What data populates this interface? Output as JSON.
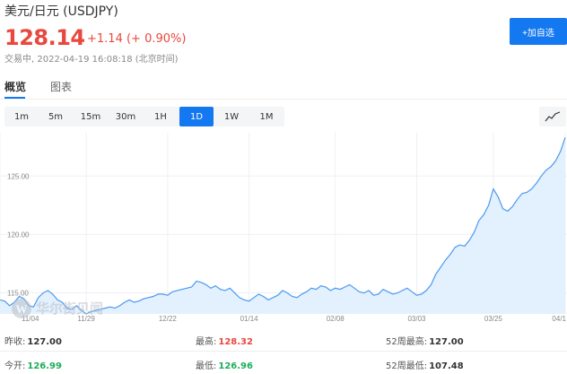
{
  "header": {
    "title": "美元/日元 (USDJPY)",
    "price": "128.14",
    "change": "+1.14 (+ 0.90%)",
    "status": "交易中, 2022-04-19 16:08:18 (北京时间)",
    "add_label": "+加自选"
  },
  "tabs": [
    {
      "label": "概览",
      "active": true
    },
    {
      "label": "图表",
      "active": false
    }
  ],
  "ranges": [
    {
      "label": "1m",
      "active": false
    },
    {
      "label": "5m",
      "active": false
    },
    {
      "label": "15m",
      "active": false
    },
    {
      "label": "30m",
      "active": false
    },
    {
      "label": "1H",
      "active": false
    },
    {
      "label": "1D",
      "active": true
    },
    {
      "label": "1W",
      "active": false
    },
    {
      "label": "1M",
      "active": false
    }
  ],
  "watermark": "华尔街见闻",
  "colors": {
    "accent": "#1478f0",
    "up": "#e8483e",
    "down": "#1cae5a",
    "line": "#4a9af0",
    "fill": "#e3f0fd"
  },
  "chart_data": {
    "type": "area",
    "y_ticks": [
      "125.00",
      "120.00",
      "115.00"
    ],
    "y_tick_values": [
      125,
      120,
      115
    ],
    "ylim": [
      113.2,
      128.4
    ],
    "x_ticks": [
      "11/04",
      "11/29",
      "12/22",
      "01/14",
      "02/08",
      "03/03",
      "03/25",
      "04/1"
    ],
    "x_tick_index": [
      0,
      18,
      35,
      52,
      70,
      87,
      103,
      118
    ],
    "values": [
      114.4,
      114.3,
      113.9,
      114.2,
      114.7,
      114.5,
      113.9,
      113.8,
      114.6,
      115.0,
      115.2,
      114.9,
      114.4,
      114.2,
      113.7,
      113.6,
      113.9,
      113.5,
      113.2,
      113.4,
      113.5,
      113.6,
      113.7,
      113.8,
      113.7,
      113.9,
      114.2,
      114.4,
      114.2,
      114.3,
      114.5,
      114.6,
      114.7,
      114.9,
      114.9,
      114.8,
      115.1,
      115.2,
      115.3,
      115.4,
      115.5,
      116.0,
      115.9,
      115.7,
      115.4,
      115.6,
      115.3,
      115.2,
      115.4,
      115.0,
      114.6,
      114.4,
      114.3,
      114.6,
      114.9,
      114.7,
      114.4,
      114.6,
      114.8,
      115.2,
      115.0,
      114.7,
      114.6,
      114.9,
      115.1,
      115.4,
      115.3,
      115.6,
      115.5,
      115.2,
      115.4,
      115.3,
      115.5,
      115.7,
      115.4,
      115.1,
      115.0,
      115.2,
      114.8,
      114.9,
      115.3,
      115.1,
      114.9,
      115.0,
      115.2,
      115.4,
      115.1,
      114.8,
      114.9,
      115.2,
      115.7,
      116.6,
      117.2,
      117.8,
      118.3,
      118.9,
      119.1,
      119.0,
      119.5,
      120.2,
      121.2,
      121.7,
      122.5,
      123.9,
      123.2,
      122.2,
      122.0,
      122.4,
      123.0,
      123.5,
      123.6,
      123.9,
      124.4,
      125.0,
      125.5,
      125.8,
      126.3,
      127.1,
      128.3
    ],
    "grid": true
  },
  "stats": {
    "prev_close": {
      "label": "昨收:",
      "value": "127.00"
    },
    "high": {
      "label": "最高:",
      "value": "128.32"
    },
    "high52": {
      "label": "52周最高:",
      "value": "127.00"
    },
    "open": {
      "label": "今开:",
      "value": "126.99"
    },
    "low": {
      "label": "最低:",
      "value": "126.96"
    },
    "low52": {
      "label": "52周最低:",
      "value": "107.48"
    }
  }
}
